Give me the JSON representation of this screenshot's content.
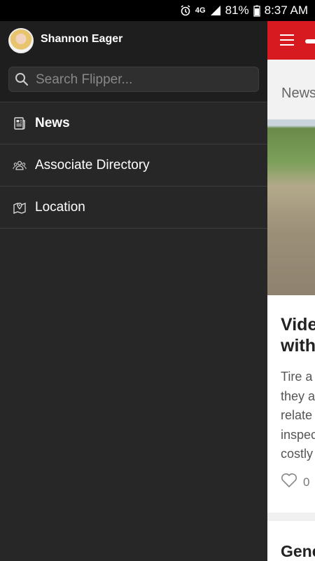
{
  "status_bar": {
    "network": "4G",
    "battery": "81%",
    "time": "8:37 AM"
  },
  "drawer": {
    "user_name": "Shannon Eager",
    "search_placeholder": "Search Flipper...",
    "items": [
      {
        "label": "News",
        "icon": "news-icon",
        "active": true
      },
      {
        "label": "Associate Directory",
        "icon": "people-icon",
        "active": false
      },
      {
        "label": "Location",
        "icon": "map-pin-icon",
        "active": false
      }
    ]
  },
  "background_app": {
    "section_title": "News",
    "article_title": "Vide\nwith",
    "article_body": "Tire a\nthey a\nrelate\ninspec\ncostly",
    "like_count": "0",
    "next_title": "Gene"
  },
  "colors": {
    "accent": "#d71920",
    "drawer_bg": "#272727"
  }
}
